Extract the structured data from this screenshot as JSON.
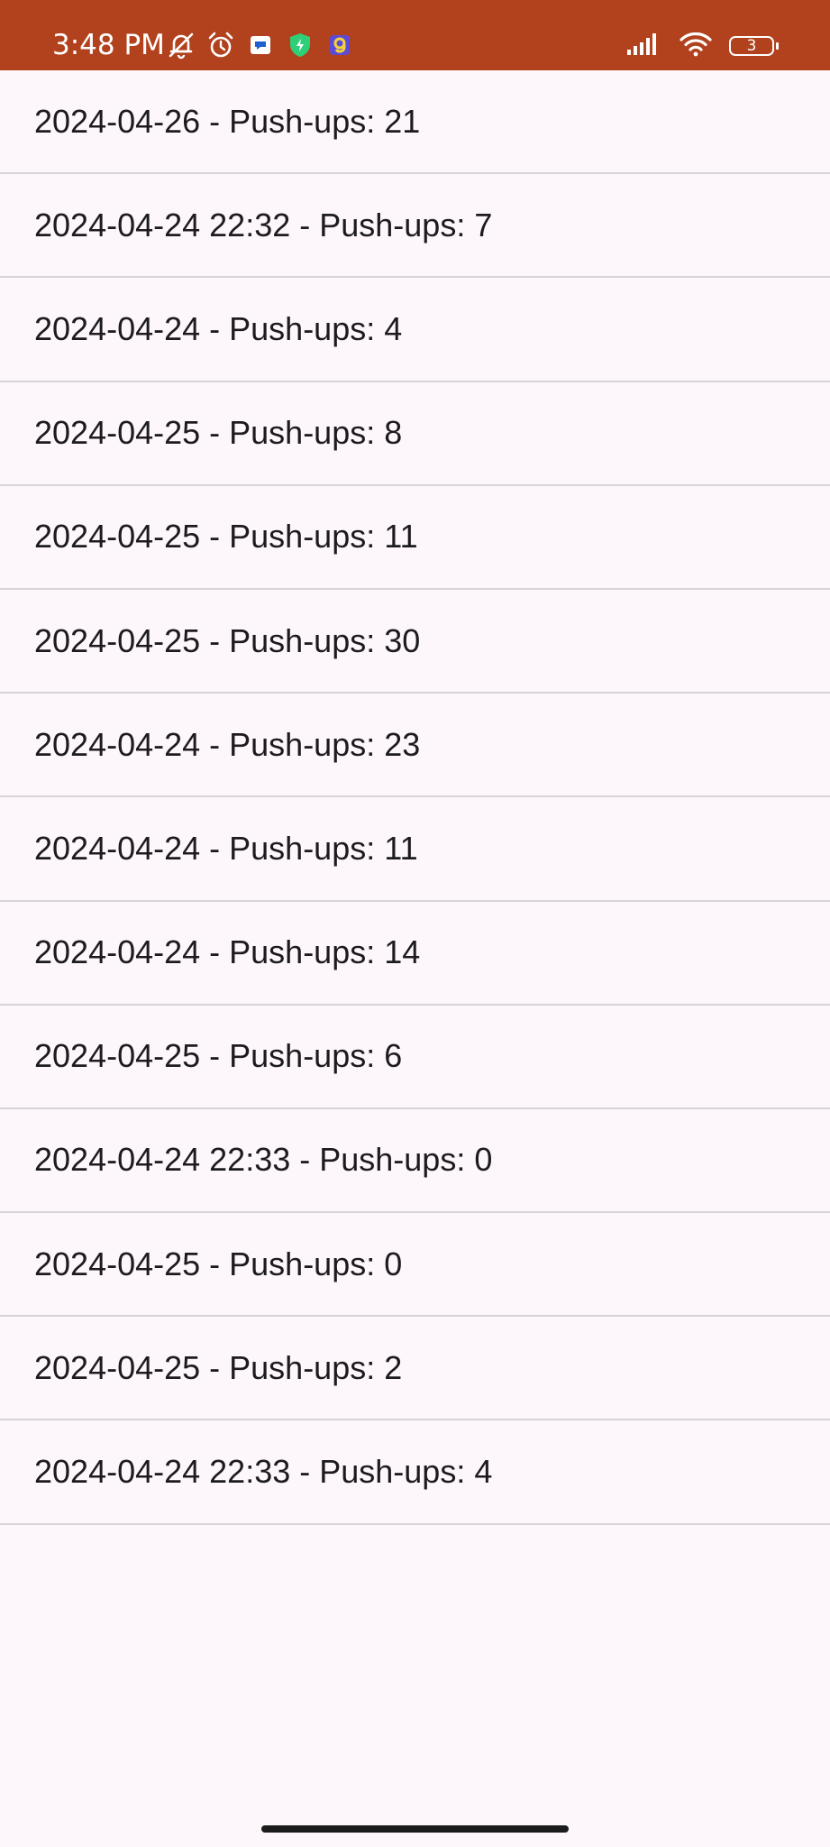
{
  "status_bar": {
    "time": "3:48 PM",
    "battery_level": "3",
    "background": "#b1421d",
    "icons_left": [
      "muted-bell-icon",
      "alarm-icon",
      "chat-app-icon",
      "shield-icon",
      "app-g-icon"
    ],
    "icons_right": [
      "signal-icon",
      "wifi-icon",
      "battery-icon"
    ]
  },
  "entries": [
    {
      "label": "2024-04-26 - Push-ups: 21"
    },
    {
      "label": "2024-04-24 22:32 - Push-ups: 7"
    },
    {
      "label": "2024-04-24 - Push-ups: 4"
    },
    {
      "label": "2024-04-25 - Push-ups: 8"
    },
    {
      "label": "2024-04-25 - Push-ups: 11"
    },
    {
      "label": "2024-04-25 - Push-ups: 30"
    },
    {
      "label": "2024-04-24 - Push-ups: 23"
    },
    {
      "label": "2024-04-24 - Push-ups: 11"
    },
    {
      "label": "2024-04-24 - Push-ups: 14"
    },
    {
      "label": "2024-04-25 - Push-ups: 6"
    },
    {
      "label": "2024-04-24 22:33 - Push-ups: 0"
    },
    {
      "label": "2024-04-25 - Push-ups: 0"
    },
    {
      "label": "2024-04-25 - Push-ups: 2"
    },
    {
      "label": "2024-04-24 22:33 - Push-ups: 4"
    }
  ],
  "colors": {
    "background": "#fdf7fc",
    "divider": "#d8d3d8",
    "text": "#1d1b20"
  }
}
